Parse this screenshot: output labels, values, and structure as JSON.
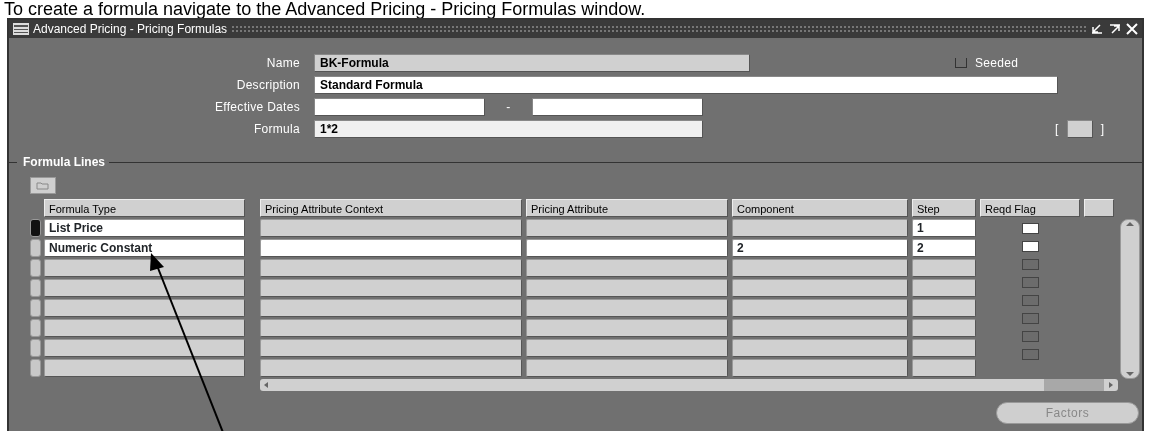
{
  "caption": "To create a formula navigate to the Advanced Pricing - Pricing Formulas window.",
  "window": {
    "title": "Advanced Pricing - Pricing Formulas"
  },
  "form": {
    "name": {
      "label": "Name",
      "value": "BK-Formula"
    },
    "seeded": {
      "label": "Seeded",
      "checked": false
    },
    "description": {
      "label": "Description",
      "value": "Standard Formula"
    },
    "effective_dates": {
      "label": "Effective Dates",
      "separator": "-"
    },
    "formula": {
      "label": "Formula",
      "value": "1*2"
    },
    "bracket_open": "[",
    "bracket_close": "]"
  },
  "formula_lines": {
    "title": "Formula Lines",
    "columns": [
      "Formula Type",
      "Pricing Attribute Context",
      "Pricing Attribute",
      "Component",
      "Step",
      "Reqd Flag"
    ],
    "rows": [
      {
        "current": true,
        "cells": [
          {
            "editable": true,
            "text": "List Price"
          },
          {
            "editable": false
          },
          {
            "editable": false
          },
          {
            "editable": false
          },
          {
            "editable": true,
            "text": "1"
          }
        ],
        "reqd_flag": {
          "enabled": true,
          "checked": false
        }
      },
      {
        "current": false,
        "cells": [
          {
            "editable": true,
            "text": "Numeric Constant"
          },
          {
            "editable": true
          },
          {
            "editable": true
          },
          {
            "editable": true,
            "text": "2"
          },
          {
            "editable": true,
            "text": "2"
          }
        ],
        "reqd_flag": {
          "enabled": true,
          "checked": false
        }
      },
      {
        "current": false,
        "cells": [
          {
            "editable": false
          },
          {
            "editable": false
          },
          {
            "editable": false
          },
          {
            "editable": false
          },
          {
            "editable": false
          }
        ],
        "reqd_flag": {
          "enabled": false,
          "checked": false
        }
      },
      {
        "current": false,
        "cells": [
          {
            "editable": false
          },
          {
            "editable": false
          },
          {
            "editable": false
          },
          {
            "editable": false
          },
          {
            "editable": false
          }
        ],
        "reqd_flag": {
          "enabled": false,
          "checked": false
        }
      },
      {
        "current": false,
        "cells": [
          {
            "editable": false
          },
          {
            "editable": false
          },
          {
            "editable": false
          },
          {
            "editable": false
          },
          {
            "editable": false
          }
        ],
        "reqd_flag": {
          "enabled": false,
          "checked": false
        }
      },
      {
        "current": false,
        "cells": [
          {
            "editable": false
          },
          {
            "editable": false
          },
          {
            "editable": false
          },
          {
            "editable": false
          },
          {
            "editable": false
          }
        ],
        "reqd_flag": {
          "enabled": false,
          "checked": false
        }
      },
      {
        "current": false,
        "cells": [
          {
            "editable": false
          },
          {
            "editable": false
          },
          {
            "editable": false
          },
          {
            "editable": false
          },
          {
            "editable": false
          }
        ],
        "reqd_flag": {
          "enabled": false,
          "checked": false
        }
      },
      {
        "current": false,
        "cells": [
          {
            "editable": false
          },
          {
            "editable": false
          },
          {
            "editable": false
          },
          {
            "editable": false
          },
          {
            "editable": false
          }
        ],
        "reqd_flag": {
          "enabled": false,
          "checked": false
        }
      }
    ]
  },
  "buttons": {
    "factors": {
      "label": "Factors",
      "disabled": true
    }
  }
}
